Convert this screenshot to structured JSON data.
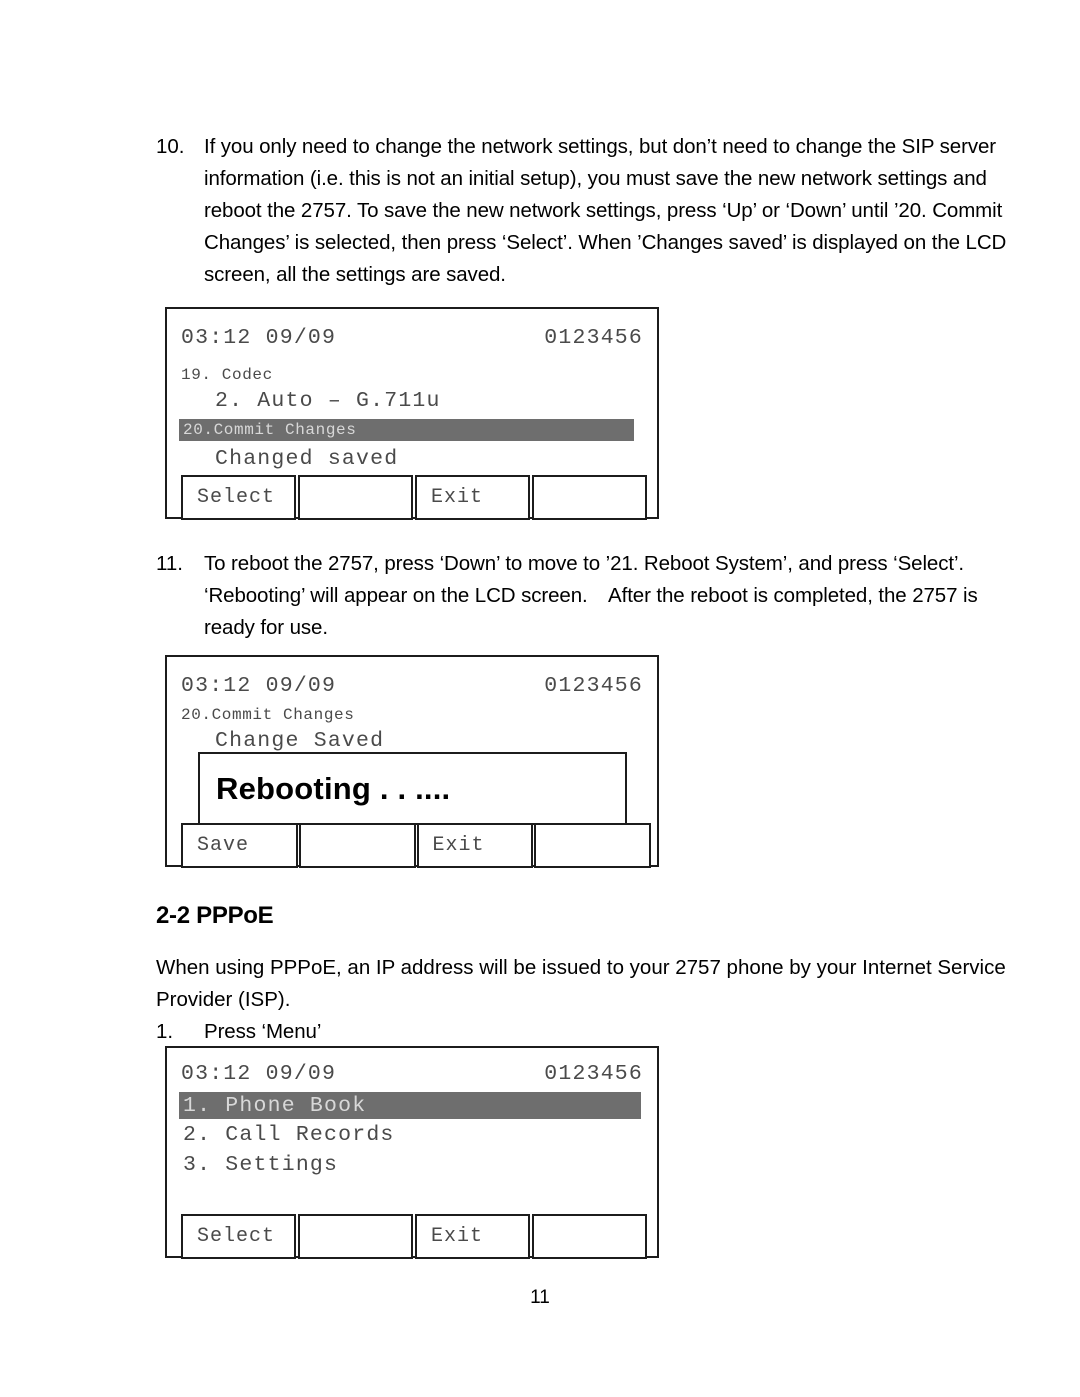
{
  "document": {
    "page_number": "11",
    "section_heading": "2-2 PPPoE"
  },
  "steps": [
    {
      "number": "10.",
      "lines": [
        "If you only need to change the network settings, but don’t need to change the SIP server",
        "information (i.e. this is not an initial setup), you must save the new network settings and",
        "reboot the 2757. To save the new network settings, press ‘Up’ or ‘Down’ until ’20. Commit",
        "Changes’ is selected, then press ‘Select’. When ’Changes saved’ is displayed on the LCD",
        "screen, all the settings are saved."
      ]
    },
    {
      "number": "11.",
      "lines": [
        "To reboot the 2757, press ‘Down’ to move to ’21. Reboot System’, and press ‘Select’.",
        "‘Rebooting’ will appear on the LCD screen. After the reboot is completed, the 2757 is",
        "ready for use."
      ]
    }
  ],
  "pppoe_intro": {
    "lines": [
      "When using PPPoE, an IP address will be issued to your 2757 phone by your Internet Service",
      "Provider (ISP)."
    ]
  },
  "pppoe_step1": {
    "number": "1.",
    "lines": [
      "Press ‘Menu’"
    ]
  },
  "screens": [
    {
      "id": "lcd-commit-changes",
      "status_time": "03:12 09/09",
      "status_number": "0123456",
      "line_small": "19. Codec",
      "line_large": "2. Auto – G.711u",
      "highlight_row": "20.Commit Changes",
      "line_below": "Changed saved",
      "softkeys": [
        "Select",
        "",
        "Exit",
        ""
      ]
    },
    {
      "id": "lcd-rebooting",
      "status_time": "03:12 09/09",
      "status_number": "0123456",
      "line_small": "20.Commit Changes",
      "line_large": "Change Saved",
      "overlay_text": "Rebooting . . ....",
      "softkeys": [
        "Save",
        "",
        "Exit",
        ""
      ]
    },
    {
      "id": "lcd-main-menu",
      "status_time": "03:12 09/09",
      "status_number": "0123456",
      "highlight_row": "1. Phone Book",
      "menu_items": [
        "2. Call Records",
        "3. Settings"
      ],
      "softkeys": [
        "Select",
        "",
        "Exit",
        ""
      ]
    }
  ],
  "colors": {
    "highlight_bg": "#6e6e6e",
    "highlight_fg": "#d8d8d8",
    "lcd_fg": "#4a4a4a",
    "border": "#1c1c1c"
  }
}
